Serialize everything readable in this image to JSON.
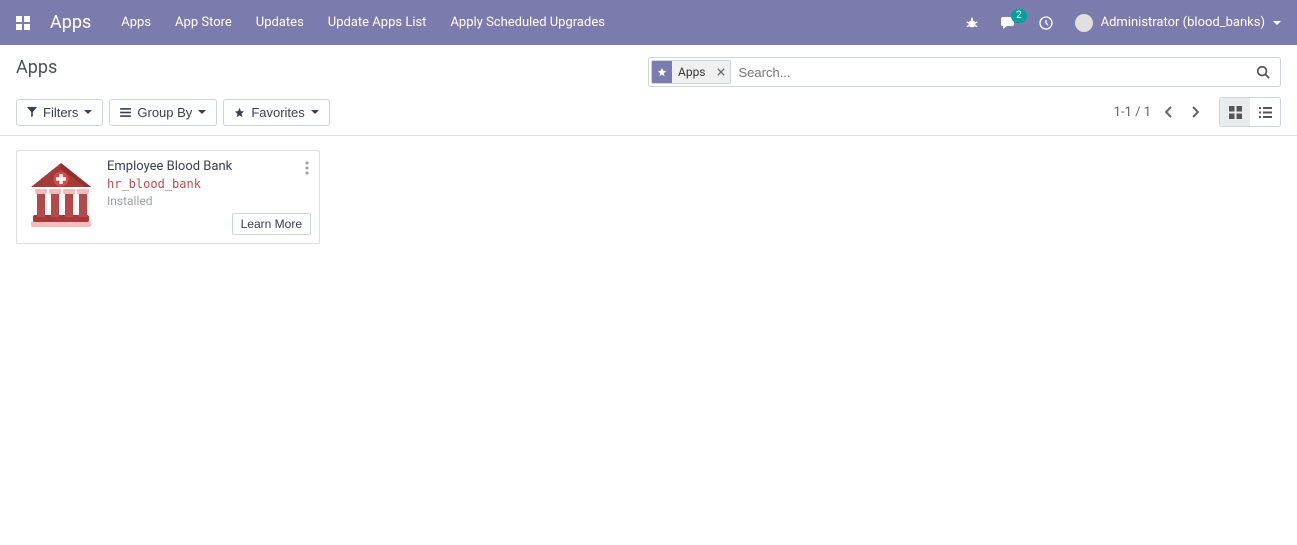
{
  "navbar": {
    "brand": "Apps",
    "menu": [
      "Apps",
      "App Store",
      "Updates",
      "Update Apps List",
      "Apply Scheduled Upgrades"
    ],
    "message_count": "2",
    "user_label": "Administrator (blood_banks)"
  },
  "control_panel": {
    "breadcrumb": "Apps",
    "search": {
      "facet_label": "Apps",
      "placeholder": "Search..."
    },
    "filters_label": "Filters",
    "groupby_label": "Group By",
    "favorites_label": "Favorites",
    "pager": "1-1 / 1"
  },
  "card": {
    "title": "Employee Blood Bank",
    "technical_name": "hr_blood_bank",
    "status": "Installed",
    "learn_more": "Learn More"
  }
}
